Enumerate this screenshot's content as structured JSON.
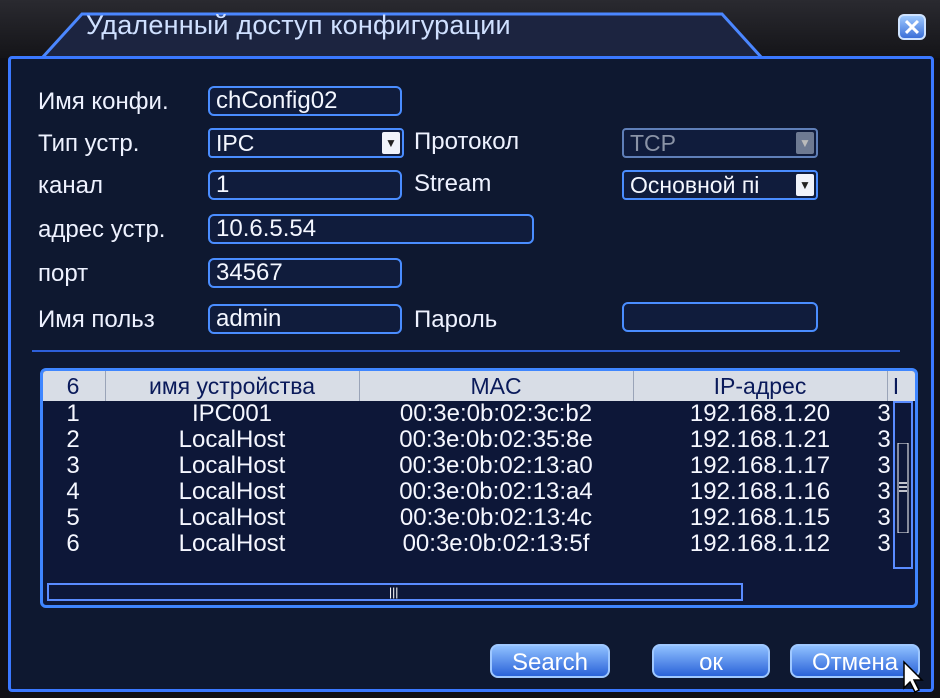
{
  "window": {
    "title": "Удаленный доступ конфигурации",
    "close_icon": "close-icon"
  },
  "form": {
    "config_name_label": "Имя конфи.",
    "config_name_value": "chConfig02",
    "device_type_label": "Тип устр.",
    "device_type_value": "IPC",
    "protocol_label": "Протокол",
    "protocol_value": "TCP",
    "channel_label": "канал",
    "channel_value": "1",
    "stream_label": "Stream",
    "stream_value": "Основной пі",
    "address_label": "адрес устр.",
    "address_value": "10.6.5.54",
    "port_label": "порт",
    "port_value": "34567",
    "user_label": "Имя польз",
    "user_value": "admin",
    "password_label": "Пароль",
    "password_value": ""
  },
  "table": {
    "headers": [
      "6",
      "имя устройства",
      "MAC",
      "IP-адрес",
      "I"
    ],
    "rows": [
      {
        "no": "1",
        "name": "IPC001",
        "mac": "00:3e:0b:02:3c:b2",
        "ip": "192.168.1.20",
        "extra": "3"
      },
      {
        "no": "2",
        "name": "LocalHost",
        "mac": "00:3e:0b:02:35:8e",
        "ip": "192.168.1.21",
        "extra": "3"
      },
      {
        "no": "3",
        "name": "LocalHost",
        "mac": "00:3e:0b:02:13:a0",
        "ip": "192.168.1.17",
        "extra": "3"
      },
      {
        "no": "4",
        "name": "LocalHost",
        "mac": "00:3e:0b:02:13:a4",
        "ip": "192.168.1.16",
        "extra": "3"
      },
      {
        "no": "5",
        "name": "LocalHost",
        "mac": "00:3e:0b:02:13:4c",
        "ip": "192.168.1.15",
        "extra": "3"
      },
      {
        "no": "6",
        "name": "LocalHost",
        "mac": "00:3e:0b:02:13:5f",
        "ip": "192.168.1.12",
        "extra": "3"
      }
    ]
  },
  "buttons": {
    "search": "Search",
    "ok": "ок",
    "cancel": "Отмена"
  },
  "colors": {
    "accent": "#3a78ff",
    "panel": "#0e1830",
    "header_bg": "#d8dde6"
  }
}
